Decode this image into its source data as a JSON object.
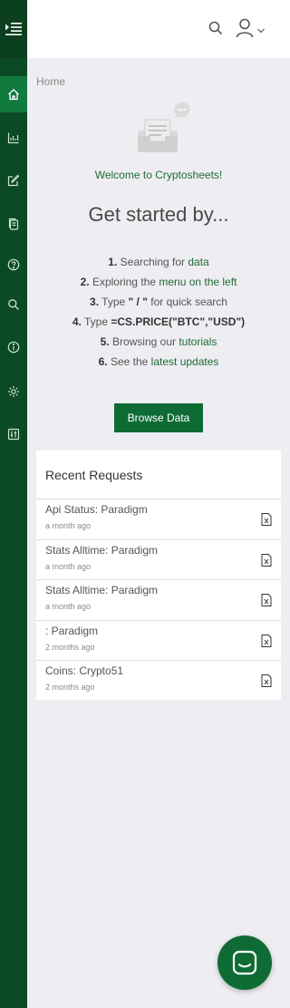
{
  "sidebar": {
    "items": [
      {
        "icon": "home-icon",
        "active": true
      },
      {
        "icon": "chart-icon"
      },
      {
        "icon": "edit-icon"
      },
      {
        "icon": "documents-icon"
      },
      {
        "icon": "help-icon"
      },
      {
        "icon": "search-icon"
      },
      {
        "icon": "info-icon"
      },
      {
        "icon": "settings-icon"
      },
      {
        "icon": "sliders-icon"
      }
    ]
  },
  "breadcrumb": "Home",
  "welcome": "Welcome to Cryptosheets!",
  "heading": "Get started by...",
  "steps": {
    "s1": {
      "num": "1.",
      "pre": "Searching for",
      "link": "data"
    },
    "s2": {
      "num": "2.",
      "pre": "Exploring the",
      "link": "menu on the left"
    },
    "s3": {
      "num": "3.",
      "pre": "Type",
      "code": "\" / \"",
      "post": "for quick search"
    },
    "s4": {
      "num": "4.",
      "pre": "Type",
      "code": "=CS.PRICE(\"BTC\",\"USD\")"
    },
    "s5": {
      "num": "5.",
      "pre": "Browsing our",
      "link": "tutorials"
    },
    "s6": {
      "num": "6.",
      "pre": "See the",
      "link": "latest updates"
    }
  },
  "browse_button": "Browse Data",
  "recent": {
    "title": "Recent Requests",
    "items": [
      {
        "name": "Api Status: Paradigm",
        "time": "a month ago"
      },
      {
        "name": "Stats Alltime: Paradigm",
        "time": "a month ago"
      },
      {
        "name": "Stats Alltime: Paradigm",
        "time": "a month ago"
      },
      {
        "name": ": Paradigm",
        "time": "2 months ago"
      },
      {
        "name": "Coins: Crypto51",
        "time": "2 months ago"
      }
    ]
  },
  "colors": {
    "brand": "#0f6b34",
    "sidebar": "#0a4a24",
    "link": "#1e6b35"
  }
}
